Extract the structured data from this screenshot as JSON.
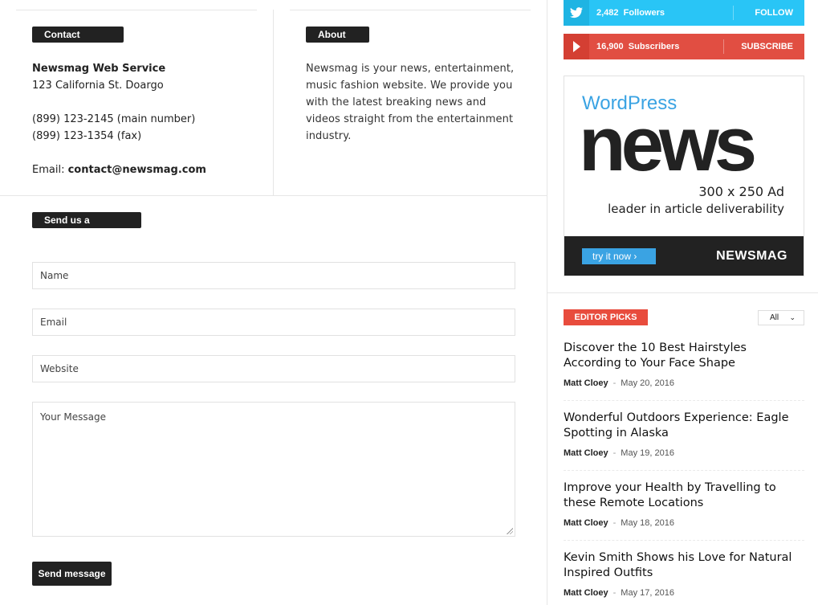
{
  "contact": {
    "section_label": "Contact Details",
    "company": "Newsmag Web Service",
    "address": "123 California St. Doargo",
    "phone_main": "(899) 123-2145 (main number)",
    "phone_fax": "(899) 123-1354 (fax)",
    "email_label": "Email: ",
    "email": "contact@newsmag.com"
  },
  "about": {
    "section_label": "About us",
    "text": "Newsmag is your news, entertainment, music fashion website. We provide you with the latest breaking news and videos straight from the entertainment industry."
  },
  "form": {
    "section_label": "Send us a message!",
    "name_placeholder": "Name",
    "email_placeholder": "Email",
    "website_placeholder": "Website",
    "message_placeholder": "Your Message",
    "submit_label": "Send message"
  },
  "social": {
    "twitter": {
      "count": "2,482",
      "unit": "Followers",
      "action": "FOLLOW",
      "color": "#29c5f6"
    },
    "youtube": {
      "count": "16,900",
      "unit": "Subscribers",
      "action": "SUBSCRIBE",
      "color": "#e14e42"
    }
  },
  "ad": {
    "brand_top": "WordPress",
    "brand_big": "news",
    "size_text": "300 x 250 Ad",
    "tagline": "leader in article deliverability",
    "cta": "try it now ›",
    "brand_bottom": "NEWSMAG"
  },
  "editor_picks": {
    "label": "EDITOR PICKS",
    "filter": "All",
    "articles": [
      {
        "title": "Discover the 10 Best Hairstyles According to Your Face Shape",
        "author": "Matt Cloey",
        "date": "May 20, 2016"
      },
      {
        "title": "Wonderful Outdoors Experience: Eagle Spotting in Alaska",
        "author": "Matt Cloey",
        "date": "May 19, 2016"
      },
      {
        "title": "Improve your Health by Travelling to these Remote Locations",
        "author": "Matt Cloey",
        "date": "May 18, 2016"
      },
      {
        "title": "Kevin Smith Shows his Love for Natural Inspired Outfits",
        "author": "Matt Cloey",
        "date": "May 17, 2016"
      }
    ]
  }
}
